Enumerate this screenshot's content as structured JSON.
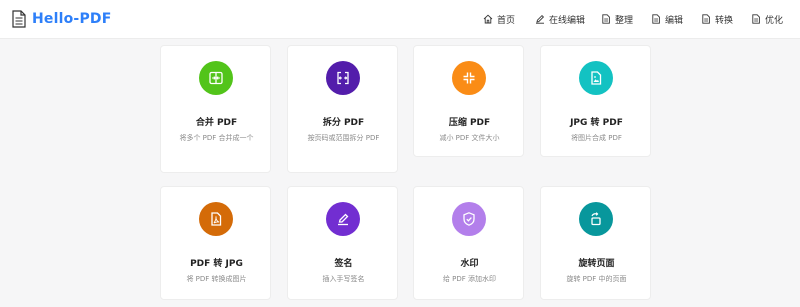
{
  "header": {
    "brand": "Hello-PDF",
    "nav": [
      {
        "label": "首页",
        "icon": "home-icon"
      },
      {
        "label": "在线编辑",
        "icon": "pen-icon"
      },
      {
        "label": "整理",
        "icon": "file-icon"
      },
      {
        "label": "编辑",
        "icon": "file-icon"
      },
      {
        "label": "转换",
        "icon": "file-icon"
      },
      {
        "label": "优化",
        "icon": "file-icon"
      }
    ]
  },
  "tools": [
    {
      "title": "合并 PDF",
      "desc": "将多个 PDF 合并成一个",
      "color": "#52c41a",
      "icon": "merge-icon"
    },
    {
      "title": "拆分 PDF",
      "desc": "按页码或范围拆分 PDF",
      "color": "#531dab",
      "icon": "split-icon"
    },
    {
      "title": "压缩 PDF",
      "desc": "减小 PDF 文件大小",
      "color": "#fa8c16",
      "icon": "compress-icon"
    },
    {
      "title": "JPG 转 PDF",
      "desc": "将图片合成 PDF",
      "color": "#13c2c2",
      "icon": "image-file-icon"
    },
    {
      "title": "PDF 转 JPG",
      "desc": "将 PDF 转换成图片",
      "color": "#d46b08",
      "icon": "pdf-file-icon"
    },
    {
      "title": "签名",
      "desc": "插入手写签名",
      "color": "#722ed1",
      "icon": "signature-icon"
    },
    {
      "title": "水印",
      "desc": "给 PDF 添加水印",
      "color": "#b37feb",
      "icon": "shield-icon"
    },
    {
      "title": "旋转页面",
      "desc": "旋转 PDF 中的页面",
      "color": "#08979c",
      "icon": "rotate-icon"
    }
  ]
}
